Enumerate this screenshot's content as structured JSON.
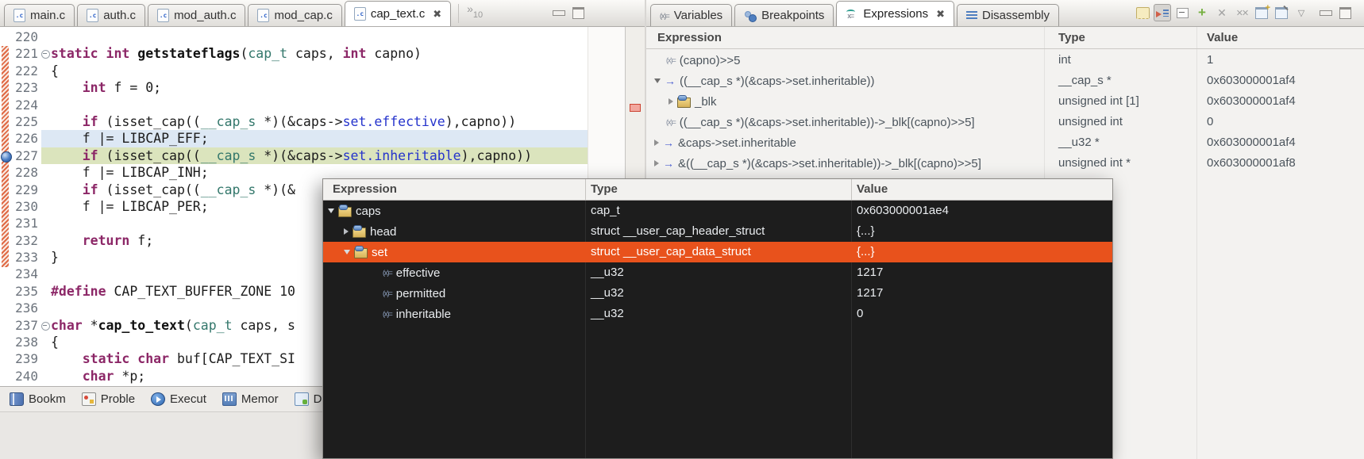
{
  "colors": {
    "selection_orange": "#e8521c",
    "debug_line_green": "#dbe4bd",
    "last_line_blue": "#dde8f4",
    "popup_bg": "#1d1d1d",
    "keyword_purple": "#8c2767",
    "member_blue": "#2533cc",
    "typedef_teal": "#33776b",
    "change_bar_orange": "#e06a45",
    "ruler_marker_red": "#f2a79e"
  },
  "editor": {
    "tabs": [
      {
        "label": "main.c",
        "active": false
      },
      {
        "label": "auth.c",
        "active": false
      },
      {
        "label": "mod_auth.c",
        "active": false
      },
      {
        "label": "mod_cap.c",
        "active": false
      },
      {
        "label": "cap_text.c",
        "active": true
      }
    ],
    "close_glyph": "✖",
    "overflow": {
      "chevrons": "»",
      "count": "10"
    },
    "file_icon_glyph": ".c",
    "lines": [
      {
        "n": "220",
        "segs": []
      },
      {
        "n": "221",
        "fold": true,
        "segs": [
          {
            "t": "static",
            "c": "kw"
          },
          {
            "t": " ",
            "c": ""
          },
          {
            "t": "int",
            "c": "kw"
          },
          {
            "t": " ",
            "c": ""
          },
          {
            "t": "getstateflags",
            "c": "fn"
          },
          {
            "t": "(",
            "c": ""
          },
          {
            "t": "cap_t",
            "c": "ty"
          },
          {
            "t": " caps, ",
            "c": ""
          },
          {
            "t": "int",
            "c": "kw"
          },
          {
            "t": " capno)",
            "c": ""
          }
        ]
      },
      {
        "n": "222",
        "segs": [
          {
            "t": "{",
            "c": ""
          }
        ]
      },
      {
        "n": "223",
        "segs": [
          {
            "t": "    ",
            "c": ""
          },
          {
            "t": "int",
            "c": "kw"
          },
          {
            "t": " f = 0;",
            "c": ""
          }
        ]
      },
      {
        "n": "224",
        "segs": []
      },
      {
        "n": "225",
        "segs": [
          {
            "t": "    ",
            "c": ""
          },
          {
            "t": "if",
            "c": "kw"
          },
          {
            "t": " (isset_cap((",
            "c": ""
          },
          {
            "t": "__cap_s",
            "c": "ty"
          },
          {
            "t": " *)(&caps->",
            "c": ""
          },
          {
            "t": "set.effective",
            "c": "mem"
          },
          {
            "t": "),capno))",
            "c": ""
          }
        ]
      },
      {
        "n": "226",
        "hl": "blue",
        "segs": [
          {
            "t": "    f |= LIBCAP_EFF;",
            "c": ""
          }
        ]
      },
      {
        "n": "227",
        "hl": "green",
        "bp": true,
        "segs": [
          {
            "t": "    ",
            "c": ""
          },
          {
            "t": "if",
            "c": "kw"
          },
          {
            "t": " (isset_cap((",
            "c": ""
          },
          {
            "t": "__cap_s",
            "c": "ty"
          },
          {
            "t": " *)(&caps->",
            "c": ""
          },
          {
            "t": "set.inheritable",
            "c": "mem"
          },
          {
            "t": "),capno))",
            "c": ""
          }
        ]
      },
      {
        "n": "228",
        "segs": [
          {
            "t": "    f |= LIBCAP_INH;",
            "c": ""
          }
        ]
      },
      {
        "n": "229",
        "segs": [
          {
            "t": "    ",
            "c": ""
          },
          {
            "t": "if",
            "c": "kw"
          },
          {
            "t": " (isset_cap((",
            "c": ""
          },
          {
            "t": "__cap_s",
            "c": "ty"
          },
          {
            "t": " *)(&",
            "c": ""
          }
        ]
      },
      {
        "n": "230",
        "segs": [
          {
            "t": "    f |= LIBCAP_PER;",
            "c": ""
          }
        ]
      },
      {
        "n": "231",
        "segs": []
      },
      {
        "n": "232",
        "segs": [
          {
            "t": "    ",
            "c": ""
          },
          {
            "t": "return",
            "c": "kw"
          },
          {
            "t": " f;",
            "c": ""
          }
        ]
      },
      {
        "n": "233",
        "segs": [
          {
            "t": "}",
            "c": ""
          }
        ]
      },
      {
        "n": "234",
        "segs": []
      },
      {
        "n": "235",
        "segs": [
          {
            "t": "#define",
            "c": "kw"
          },
          {
            "t": " CAP_TEXT_BUFFER_ZONE 10",
            "c": ""
          }
        ]
      },
      {
        "n": "236",
        "segs": []
      },
      {
        "n": "237",
        "fold": true,
        "segs": [
          {
            "t": "char",
            "c": "kw"
          },
          {
            "t": " *",
            "c": ""
          },
          {
            "t": "cap_to_text",
            "c": "fn"
          },
          {
            "t": "(",
            "c": ""
          },
          {
            "t": "cap_t",
            "c": "ty"
          },
          {
            "t": " caps, s",
            "c": ""
          }
        ]
      },
      {
        "n": "238",
        "segs": [
          {
            "t": "{",
            "c": ""
          }
        ]
      },
      {
        "n": "239",
        "segs": [
          {
            "t": "    ",
            "c": ""
          },
          {
            "t": "static",
            "c": "kw"
          },
          {
            "t": " ",
            "c": ""
          },
          {
            "t": "char",
            "c": "kw"
          },
          {
            "t": " buf[CAP_TEXT_SI",
            "c": ""
          }
        ]
      },
      {
        "n": "240",
        "segs": [
          {
            "t": "    ",
            "c": ""
          },
          {
            "t": "char",
            "c": "kw"
          },
          {
            "t": " *p;",
            "c": ""
          }
        ]
      }
    ],
    "fastview_items": [
      {
        "icon": "bookmarks",
        "label": "Bookm"
      },
      {
        "icon": "problems",
        "label": "Proble"
      },
      {
        "icon": "executables",
        "label": "Execut"
      },
      {
        "icon": "memory",
        "label": "Memor"
      },
      {
        "icon": "debug",
        "label": "D"
      }
    ]
  },
  "right_panel": {
    "tabs": [
      {
        "label": "Variables",
        "icon": "variables",
        "active": false
      },
      {
        "label": "Breakpoints",
        "icon": "breakpoints",
        "active": false
      },
      {
        "label": "Expressions",
        "icon": "expressions",
        "active": true
      },
      {
        "label": "Disassembly",
        "icon": "disasm",
        "active": false
      }
    ],
    "variables_icon_glyph": "(x)=",
    "expressions_icon_glyph": "x=",
    "toolbar": [
      {
        "name": "show-type-names",
        "kind": "sh-typenames"
      },
      {
        "name": "show-logical-structures",
        "kind": "sh-logical",
        "pressed": true
      },
      {
        "name": "collapse-all",
        "kind": "collapse-all"
      },
      {
        "name": "add-expression",
        "glyph": "+",
        "gclass": "glyph-add"
      },
      {
        "name": "remove-expression",
        "glyph": "✕",
        "gclass": "glyph-x"
      },
      {
        "name": "remove-all-expressions",
        "glyph": "✕✕",
        "gclass": "glyph-xx"
      },
      {
        "name": "open-new-view",
        "kind": "win-new"
      },
      {
        "name": "pin-view",
        "kind": "win-pin"
      },
      {
        "name": "view-menu",
        "glyph": "▽",
        "gclass": "glyph-menu"
      }
    ],
    "columns": [
      "Expression",
      "Type",
      "Value"
    ],
    "rows": [
      {
        "indent": 0,
        "expander": null,
        "icon": "xeq",
        "expr": "(capno)>>5",
        "type": "int",
        "value": "1"
      },
      {
        "indent": 0,
        "expander": "down",
        "icon": "arrow",
        "expr": "((__cap_s *)(&caps->set.inheritable))",
        "type": "__cap_s *",
        "value": "0x603000001af4"
      },
      {
        "indent": 1,
        "expander": "right",
        "icon": "folder",
        "expr": "_blk",
        "type": "unsigned int [1]",
        "value": "0x603000001af4"
      },
      {
        "indent": 0,
        "expander": null,
        "icon": "xeq",
        "expr": "((__cap_s *)(&caps->set.inheritable))->_blk[(capno)>>5]",
        "type": "unsigned int",
        "value": "0"
      },
      {
        "indent": 0,
        "expander": "right",
        "icon": "arrow",
        "expr": "&caps->set.inheritable",
        "type": "__u32 *",
        "value": "0x603000001af4"
      },
      {
        "indent": 0,
        "expander": "right",
        "icon": "arrow",
        "expr": "&((__cap_s *)(&caps->set.inheritable))->_blk[(capno)>>5]",
        "type": "unsigned int *",
        "value": "0x603000001af8"
      }
    ],
    "xeq_icon_glyph": "(x)=",
    "arrow_icon_glyph": "→"
  },
  "popup": {
    "columns": [
      "Expression",
      "Type",
      "Value"
    ],
    "rows": [
      {
        "indent": 0,
        "expander": "down",
        "icon": "folder",
        "name": "caps",
        "type": "cap_t",
        "value": "0x603000001ae4",
        "selected": false
      },
      {
        "indent": 1,
        "expander": "right",
        "icon": "folder",
        "name": "head",
        "type": "struct __user_cap_header_struct",
        "value": "{...}",
        "selected": false
      },
      {
        "indent": 1,
        "expander": "down",
        "icon": "folder",
        "name": "set",
        "type": "struct __user_cap_data_struct",
        "value": "{...}",
        "selected": true
      },
      {
        "indent": 2,
        "expander": null,
        "icon": "xeq",
        "name": "effective",
        "type": "__u32",
        "value": "1217",
        "selected": false
      },
      {
        "indent": 2,
        "expander": null,
        "icon": "xeq",
        "name": "permitted",
        "type": "__u32",
        "value": "1217",
        "selected": false
      },
      {
        "indent": 2,
        "expander": null,
        "icon": "xeq",
        "name": "inheritable",
        "type": "__u32",
        "value": "0",
        "selected": false
      }
    ]
  }
}
